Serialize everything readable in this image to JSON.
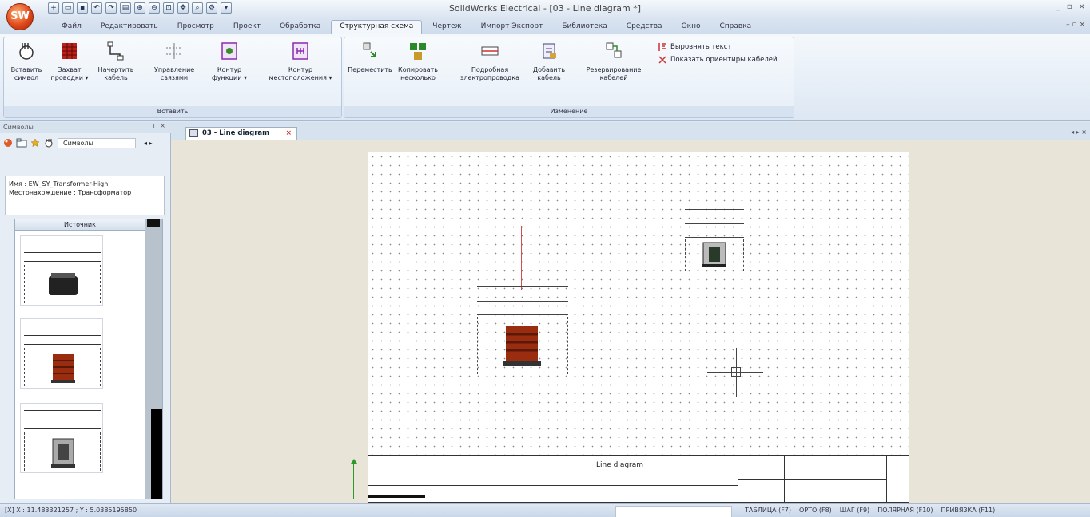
{
  "app": {
    "window_title": "SolidWorks Electrical - [03 - Line diagram *]",
    "orb_label": "SW",
    "window_controls": [
      "_",
      "▫",
      "×"
    ],
    "mdi_controls": "– ▫ ×"
  },
  "ribbon_tabs": [
    {
      "label": "Файл",
      "active": false
    },
    {
      "label": "Редактировать",
      "active": false
    },
    {
      "label": "Просмотр",
      "active": false
    },
    {
      "label": "Проект",
      "active": false
    },
    {
      "label": "Обработка",
      "active": false
    },
    {
      "label": "Структурная схема",
      "active": true
    },
    {
      "label": "Чертеж",
      "active": false
    },
    {
      "label": "Импорт Экспорт",
      "active": false
    },
    {
      "label": "Библиотека",
      "active": false
    },
    {
      "label": "Средства",
      "active": false
    },
    {
      "label": "Окно",
      "active": false
    },
    {
      "label": "Справка",
      "active": false
    }
  ],
  "ribbon": {
    "insert_group": {
      "label": "Вставить",
      "buttons": [
        {
          "label1": "Вставить",
          "label2": "символ",
          "icon": "insert-symbol-icon"
        },
        {
          "label1": "Захват",
          "label2": "проводки ▾",
          "icon": "wire-grid-icon"
        },
        {
          "label1": "Начертить",
          "label2": "кабель",
          "icon": "draw-cable-icon"
        },
        {
          "label1": "Управление",
          "label2": "связями",
          "icon": "manage-links-icon"
        },
        {
          "label1": "Контур",
          "label2": "функции ▾",
          "icon": "function-outline-icon"
        },
        {
          "label1": "Контур",
          "label2": "местоположения ▾",
          "icon": "location-outline-icon"
        }
      ]
    },
    "modify_group": {
      "label": "Изменение",
      "buttons": [
        {
          "label1": "Переместить",
          "label2": "",
          "icon": "move-icon"
        },
        {
          "label1": "Копировать",
          "label2": "несколько",
          "icon": "copy-multiple-icon"
        },
        {
          "label1": "Подробная",
          "label2": "электропроводка",
          "icon": "detailed-wiring-icon"
        },
        {
          "label1": "Добавить",
          "label2": "кабель",
          "icon": "add-cable-icon"
        },
        {
          "label1": "Резервирование",
          "label2": "кабелей",
          "icon": "cable-reservation-icon"
        }
      ],
      "small_buttons": [
        {
          "label": "Выровнять текст",
          "icon": "align-text-icon"
        },
        {
          "label": "Показать ориентиры кабелей",
          "icon": "show-cable-guides-icon"
        }
      ]
    }
  },
  "left_panel": {
    "title": "Символы",
    "pin": "⊓ ×",
    "filter_label": "Символы",
    "nav": "◂ ▸",
    "info_lines": [
      "Имя : EW_SY_Transformer-High",
      "Местонахождение : Трансформатор"
    ],
    "list_header": "Источник"
  },
  "document": {
    "tab_label": "03 - Line diagram",
    "close": "×",
    "tab_nav": "◂ ▸ ×",
    "title_block_text": "Line diagram"
  },
  "status_bar": {
    "coords": "[X] X : 11.483321257 ; Y : 5.0385195850",
    "modes": [
      "ТАБЛИЦА (F7)",
      "ОРТО (F8)",
      "ШАГ (F9)",
      "ПОЛЯРНАЯ (F10)",
      "ПРИВЯЗКА (F11)"
    ]
  },
  "colors": {
    "accent_red": "#d04a2a",
    "ribbon_bg": "#dde7f3",
    "canvas_bg": "#e8e4d8"
  }
}
